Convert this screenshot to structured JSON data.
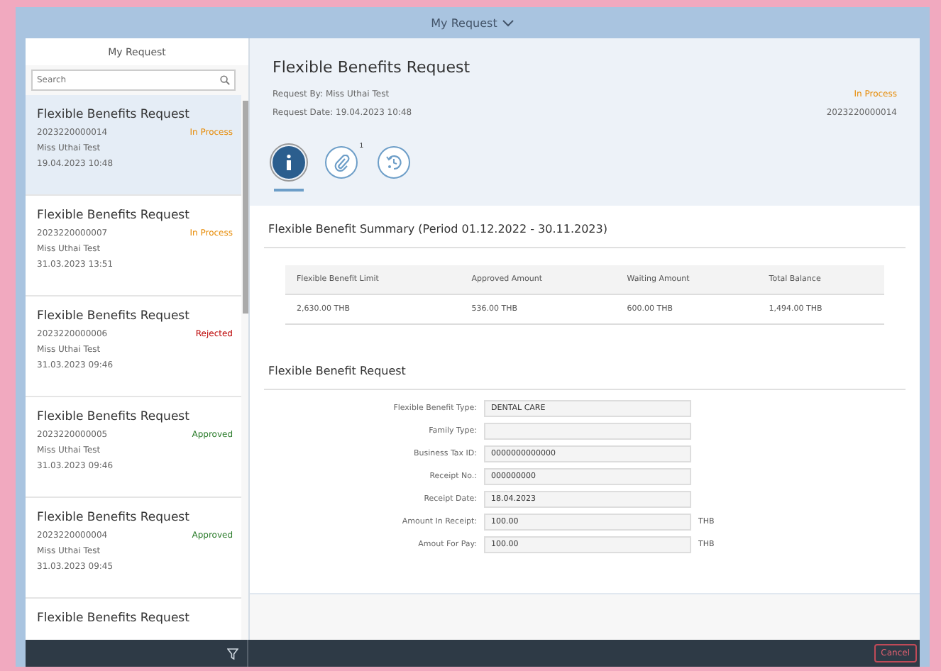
{
  "shell": {
    "title": "My Request"
  },
  "master": {
    "title": "My Request",
    "search": {
      "placeholder": "Search"
    },
    "items": [
      {
        "title": "Flexible Benefits Request",
        "number": "2023220000014",
        "status": "In Process",
        "color": "#e78c07",
        "requester": "Miss Uthai Test",
        "date": "19.04.2023 10:48",
        "selected": true
      },
      {
        "title": "Flexible Benefits Request",
        "number": "2023220000007",
        "status": "In Process",
        "color": "#e78c07",
        "requester": "Miss Uthai Test",
        "date": "31.03.2023 13:51",
        "selected": false
      },
      {
        "title": "Flexible Benefits Request",
        "number": "2023220000006",
        "status": "Rejected",
        "color": "#bb0000",
        "requester": "Miss Uthai Test",
        "date": "31.03.2023 09:46",
        "selected": false
      },
      {
        "title": "Flexible Benefits Request",
        "number": "2023220000005",
        "status": "Approved",
        "color": "#2b7c2b",
        "requester": "Miss Uthai Test",
        "date": "31.03.2023 09:46",
        "selected": false
      },
      {
        "title": "Flexible Benefits Request",
        "number": "2023220000004",
        "status": "Approved",
        "color": "#2b7c2b",
        "requester": "Miss Uthai Test",
        "date": "31.03.2023 09:45",
        "selected": false
      },
      {
        "title": "Flexible Benefits Request",
        "selected": false
      }
    ]
  },
  "detail": {
    "title": "Flexible Benefits Request",
    "requested_by": "Request By: Miss Uthai Test",
    "request_date": "Request Date: 19.04.2023 10:48",
    "status": "In Process",
    "color": "#e78c07",
    "number": "2023220000014",
    "tabs": [
      {
        "kind": "info",
        "selected": true
      },
      {
        "kind": "attachment",
        "badge": "1",
        "selected": false
      },
      {
        "kind": "history",
        "selected": false
      }
    ],
    "summary": {
      "title": "Flexible Benefit Summary (Period 01.12.2022 - 30.11.2023)",
      "columns": [
        "Flexible Benefit Limit",
        "Approved Amount",
        "Waiting Amount",
        "Total Balance"
      ],
      "rows": [
        [
          "2,630.00 THB",
          "536.00 THB",
          "600.00 THB",
          "1,494.00 THB"
        ]
      ]
    },
    "form": {
      "title": "Flexible Benefit Request",
      "fields": [
        {
          "label": "Flexible Benefit Type:",
          "value": "DENTAL CARE"
        },
        {
          "label": "Family Type:"
        },
        {
          "label": "Business Tax ID:",
          "value": "0000000000000"
        },
        {
          "label": "Receipt No.:",
          "value": "000000000"
        },
        {
          "label": "Receipt Date:",
          "value": "18.04.2023"
        },
        {
          "label": "Amount In Receipt:",
          "value": "100.00",
          "unit": "THB"
        },
        {
          "label": "Amout For Pay:",
          "value": "100.00",
          "unit": "THB"
        }
      ]
    }
  },
  "footer": {
    "cancel": "Cancel"
  }
}
